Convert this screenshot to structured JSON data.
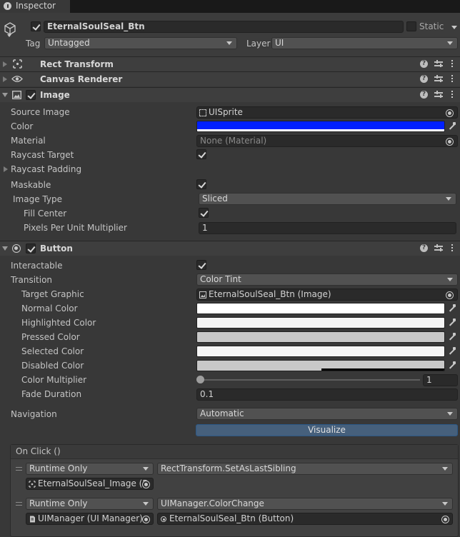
{
  "window": {
    "tab_title": "Inspector",
    "tab_icon": "info-icon"
  },
  "object": {
    "active": true,
    "name": "EternalSoulSeal_Btn",
    "static_label": "Static",
    "static_checked": false,
    "tag_label": "Tag",
    "tag_value": "Untagged",
    "layer_label": "Layer",
    "layer_value": "UI",
    "icon": "cube-icon"
  },
  "components": {
    "rect_transform": {
      "title": "Rect Transform",
      "icon": "rect-transform-icon"
    },
    "canvas_renderer": {
      "title": "Canvas Renderer",
      "icon": "eye-icon"
    },
    "image": {
      "title": "Image",
      "enabled": true,
      "icon": "image-icon",
      "source_image_label": "Source Image",
      "source_image_value": "UISprite",
      "color_label": "Color",
      "color_value": "#0020ff",
      "material_label": "Material",
      "material_value": "None (Material)",
      "raycast_target_label": "Raycast Target",
      "raycast_target_checked": true,
      "raycast_padding_label": "Raycast Padding",
      "maskable_label": "Maskable",
      "maskable_checked": true,
      "image_type_label": "Image Type",
      "image_type_value": "Sliced",
      "fill_center_label": "Fill Center",
      "fill_center_checked": true,
      "ppu_label": "Pixels Per Unit Multiplier",
      "ppu_value": "1"
    },
    "button": {
      "title": "Button",
      "enabled": true,
      "icon": "button-icon",
      "interactable_label": "Interactable",
      "interactable_checked": true,
      "transition_label": "Transition",
      "transition_value": "Color Tint",
      "target_graphic_label": "Target Graphic",
      "target_graphic_value": "EternalSoulSeal_Btn (Image)",
      "normal_color_label": "Normal Color",
      "normal_color": "#ffffff",
      "highlighted_color_label": "Highlighted Color",
      "highlighted_color": "#f5f5f5",
      "pressed_color_label": "Pressed Color",
      "pressed_color": "#c8c8c8",
      "selected_color_label": "Selected Color",
      "selected_color": "#f5f5f5",
      "disabled_color_label": "Disabled Color",
      "disabled_color": "#c8c8c8",
      "color_multiplier_label": "Color Multiplier",
      "color_multiplier_value": "1",
      "fade_duration_label": "Fade Duration",
      "fade_duration_value": "0.1",
      "navigation_label": "Navigation",
      "navigation_value": "Automatic",
      "visualize_label": "Visualize",
      "on_click": {
        "title": "On Click ()",
        "entries": [
          {
            "runtime": "Runtime Only",
            "function": "RectTransform.SetAsLastSibling",
            "target": "EternalSoulSeal_Image (R",
            "argument": ""
          },
          {
            "runtime": "Runtime Only",
            "function": "UIManager.ColorChange",
            "target": "UIManager (UI Manager)",
            "argument": "EternalSoulSeal_Btn (Button)"
          }
        ]
      }
    }
  },
  "colors": {
    "background": "#383838",
    "header": "#3e3e3e",
    "field": "#2a2a2a",
    "accent": "#46607c"
  }
}
